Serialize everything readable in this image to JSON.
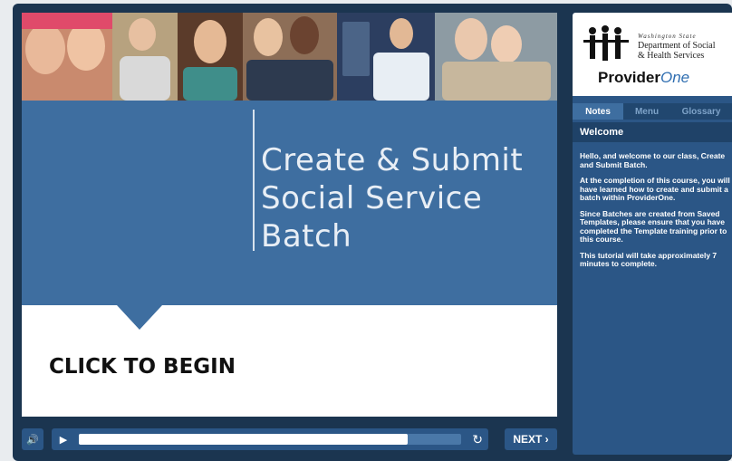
{
  "hero": {
    "title_line1": "Create & Submit",
    "title_line2": "Social Service Batch"
  },
  "cta": {
    "label": "CLICK TO BEGIN"
  },
  "player": {
    "progress": 0.86,
    "next_label": "NEXT ›",
    "volume_icon": "volume-icon",
    "play_icon": "play-icon",
    "replay_icon": "replay-icon"
  },
  "logo": {
    "state": "Washington State",
    "dept_line1": "Department of Social",
    "dept_line2": "& Health Services",
    "brand_a": "Provider",
    "brand_b": "One"
  },
  "tabs": [
    {
      "label": "Notes",
      "active": true
    },
    {
      "label": "Menu",
      "active": false
    },
    {
      "label": "Glossary",
      "active": false
    }
  ],
  "notes": {
    "heading": "Welcome",
    "paragraphs": [
      "Hello, and welcome to our class, Create and Submit Batch.",
      "At the completion of this course, you will have learned how to create and submit a batch within ProviderOne.",
      "Since Batches are created from Saved Templates, please ensure that you have completed the Template training prior to this course.",
      "This tutorial will take approximately 7 minutes to complete."
    ]
  },
  "colors": {
    "frame": "#1b3550",
    "accent": "#3e6ea0",
    "panel": "#2b5686"
  }
}
